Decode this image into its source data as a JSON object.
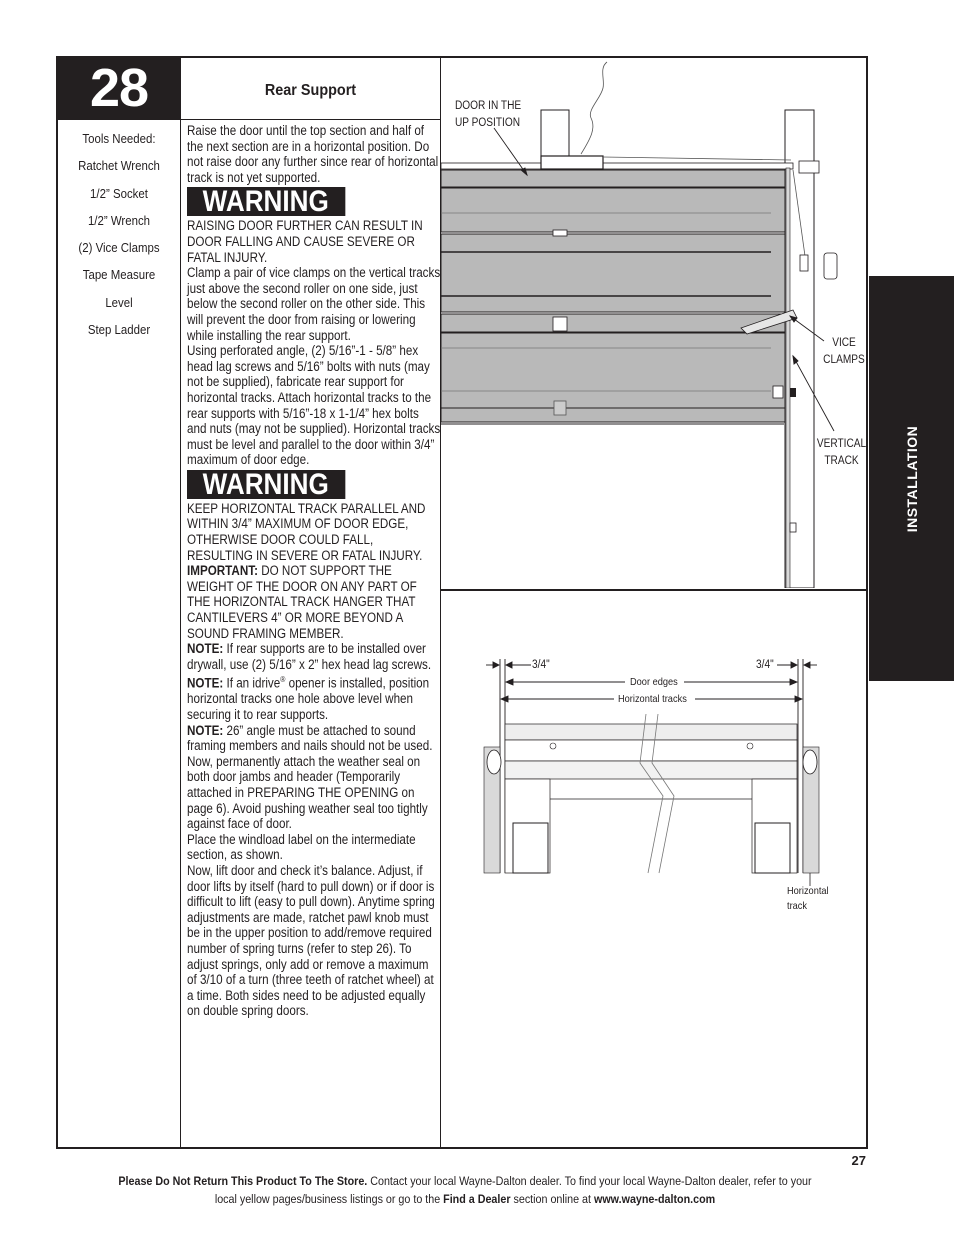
{
  "step": {
    "number": "28",
    "title": "Rear Support"
  },
  "tools": {
    "heading": "Tools Needed:",
    "items": [
      "Ratchet Wrench",
      "1/2” Socket",
      "1/2” Wrench",
      "(2) Vice Clamps",
      "Tape Measure",
      "Level",
      "Step Ladder"
    ]
  },
  "instructions": {
    "intro": "Raise the door until the top section and half of the next section are in a horizontal position.  Do not raise door any further since rear of horizontal track is not yet supported.",
    "warning1_label": "WARNING",
    "warning1_text": "RAISING DOOR FURTHER CAN RESULT IN DOOR FALLING AND CAUSE SEVERE OR FATAL INJURY.",
    "clamp": "Clamp a pair of vice clamps on the vertical tracks just above the second roller on one side, just below the second roller on the other side. This will prevent the door from raising or lowering while installing the rear support.",
    "fabricate": "Using perforated angle, (2) 5/16”-1 - 5/8” hex head lag screws and 5/16” bolts with nuts (may not be supplied), fabricate rear support for horizontal tracks.  Attach horizontal tracks to the rear supports with 5/16”-18 x 1-1/4” hex bolts and nuts (may not be supplied). Horizontal tracks must be level and parallel to the door within 3/4” maximum of door edge.",
    "warning2_label": "WARNING",
    "warning2_text": "KEEP HORIZONTAL TRACK PARALLEL AND WITHIN 3/4” MAXIMUM OF DOOR EDGE, OTHERWISE DOOR COULD FALL, RESULTING IN SEVERE OR FATAL INJURY.",
    "important_label": "IMPORTANT:",
    "important_text": " DO NOT SUPPORT THE WEIGHT OF THE DOOR ON ANY PART OF THE HORIZONTAL TRACK HANGER THAT CANTILEVERS 4” OR MORE BEYOND A SOUND FRAMING MEMBER.",
    "note1_label": "NOTE:",
    "note1_text": " If rear supports are to be installed over drywall, use (2) 5/16” x 2” hex head lag screws.",
    "note2_label": "NOTE:",
    "note2_text_a": " If an idrive",
    "note2_reg": "®",
    "note2_text_b": " opener is installed, position horizontal tracks one hole above level when securing it to rear supports.",
    "note3_label": "NOTE:",
    "note3_text": " 26” angle must be attached to sound framing members and nails should not be used.",
    "weather": "Now, permanently attach the weather seal on both door jambs and header (Temporarily attached in PREPARING THE OPENING on page 6). Avoid pushing weather seal too tightly against face of door.",
    "windload": "Place the windload label on the intermediate section, as shown.",
    "balance": "Now, lift door and check it’s balance. Adjust, if door lifts by itself (hard to pull down) or if door is difficult to lift (easy to pull down).  Anytime spring adjustments are made, ratchet pawl knob must be in the upper position to add/remove required number of spring turns (refer to step 26). To adjust springs, only add or remove a maximum of  3/10 of a turn (three teeth of ratchet wheel) at a time. Both sides need to be adjusted equally on double spring doors."
  },
  "figure_top": {
    "label_door_line1": "DOOR IN THE",
    "label_door_line2": "UP POSITION",
    "label_clamps_line1": "VICE",
    "label_clamps_line2": "CLAMPS",
    "label_track_line1": "VERTICAL",
    "label_track_line2": "TRACK"
  },
  "figure_bottom": {
    "dim_left": "3/4\"",
    "dim_right": "3/4\"",
    "door_edges": "Door edges",
    "horizontal_tracks": "Horizontal tracks",
    "callout_line1": "Horizontal",
    "callout_line2": "track"
  },
  "side_tab": "INSTALLATION",
  "page_number": "27",
  "footer": {
    "bold1": "Please Do Not Return This Product To The Store.",
    "text1": " Contact your local Wayne-Dalton dealer. To find your local Wayne-Dalton dealer, refer to your local yellow pages/business listings or go to the ",
    "bold2": "Find a Dealer",
    "text2": " section online at ",
    "bold3": "www.wayne-dalton.com"
  },
  "colors": {
    "ink": "#231f20",
    "panel_gray": "#b9b9b9",
    "track_gray": "#d9d9d9"
  }
}
